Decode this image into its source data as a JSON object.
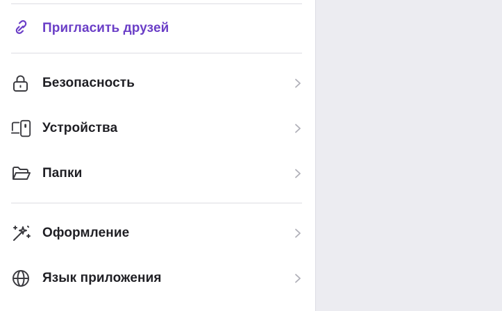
{
  "colors": {
    "accent": "#6b3fc7",
    "text": "#1f1f24",
    "icon": "#3b3b40",
    "chevron": "#b0b0b8",
    "panel_bg": "#ececf1",
    "sidebar_bg": "#ffffff"
  },
  "menu": {
    "invite": {
      "label": "Пригласить друзей",
      "icon": "link-icon"
    },
    "items": [
      {
        "label": "Безопасность",
        "icon": "lock-icon"
      },
      {
        "label": "Устройства",
        "icon": "devices-icon"
      },
      {
        "label": "Папки",
        "icon": "folder-icon"
      },
      {
        "label": "Оформление",
        "icon": "magic-wand-icon"
      },
      {
        "label": "Язык приложения",
        "icon": "globe-icon"
      }
    ]
  }
}
